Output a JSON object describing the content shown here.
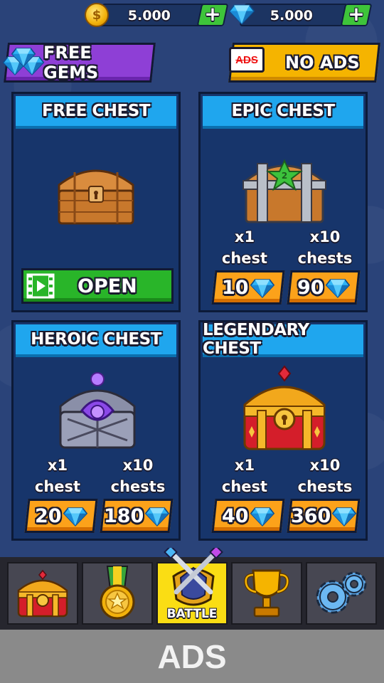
{
  "currency": {
    "coins": "5.000",
    "gems": "5.000"
  },
  "promos": {
    "free_gems_label": "FREE GEMS",
    "no_ads_label": "NO ADS",
    "ads_icon_label": "ADS"
  },
  "chests": {
    "free": {
      "title": "FREE CHEST",
      "open_label": "OPEN"
    },
    "epic": {
      "title": "EPIC CHEST",
      "opt1_qty": "x1",
      "opt1_unit": "chest",
      "opt2_qty": "x10",
      "opt2_unit": "chests",
      "price1": "10",
      "price2": "90"
    },
    "heroic": {
      "title": "HEROIC CHEST",
      "opt1_qty": "x1",
      "opt1_unit": "chest",
      "opt2_qty": "x10",
      "opt2_unit": "chests",
      "price1": "20",
      "price2": "180"
    },
    "legendary": {
      "title": "LEGENDARY CHEST",
      "opt1_qty": "x1",
      "opt1_unit": "chest",
      "opt2_qty": "x10",
      "opt2_unit": "chests",
      "price1": "40",
      "price2": "360"
    }
  },
  "nav": {
    "items": [
      {
        "icon": "chest-icon"
      },
      {
        "icon": "medal-icon"
      },
      {
        "icon": "battle-icon",
        "label": "BATTLE",
        "active": true
      },
      {
        "icon": "trophy-icon"
      },
      {
        "icon": "gears-icon"
      }
    ]
  },
  "ads_banner": "ADS",
  "colors": {
    "background": "#2a4379",
    "panel": "#17356b",
    "header_blue": "#1fa6ee",
    "price_orange": "#fca21a",
    "open_green": "#29b529",
    "free_gems_purple": "#8e3fd6",
    "no_ads_yellow": "#f5b400",
    "nav_active": "#fadd14"
  }
}
